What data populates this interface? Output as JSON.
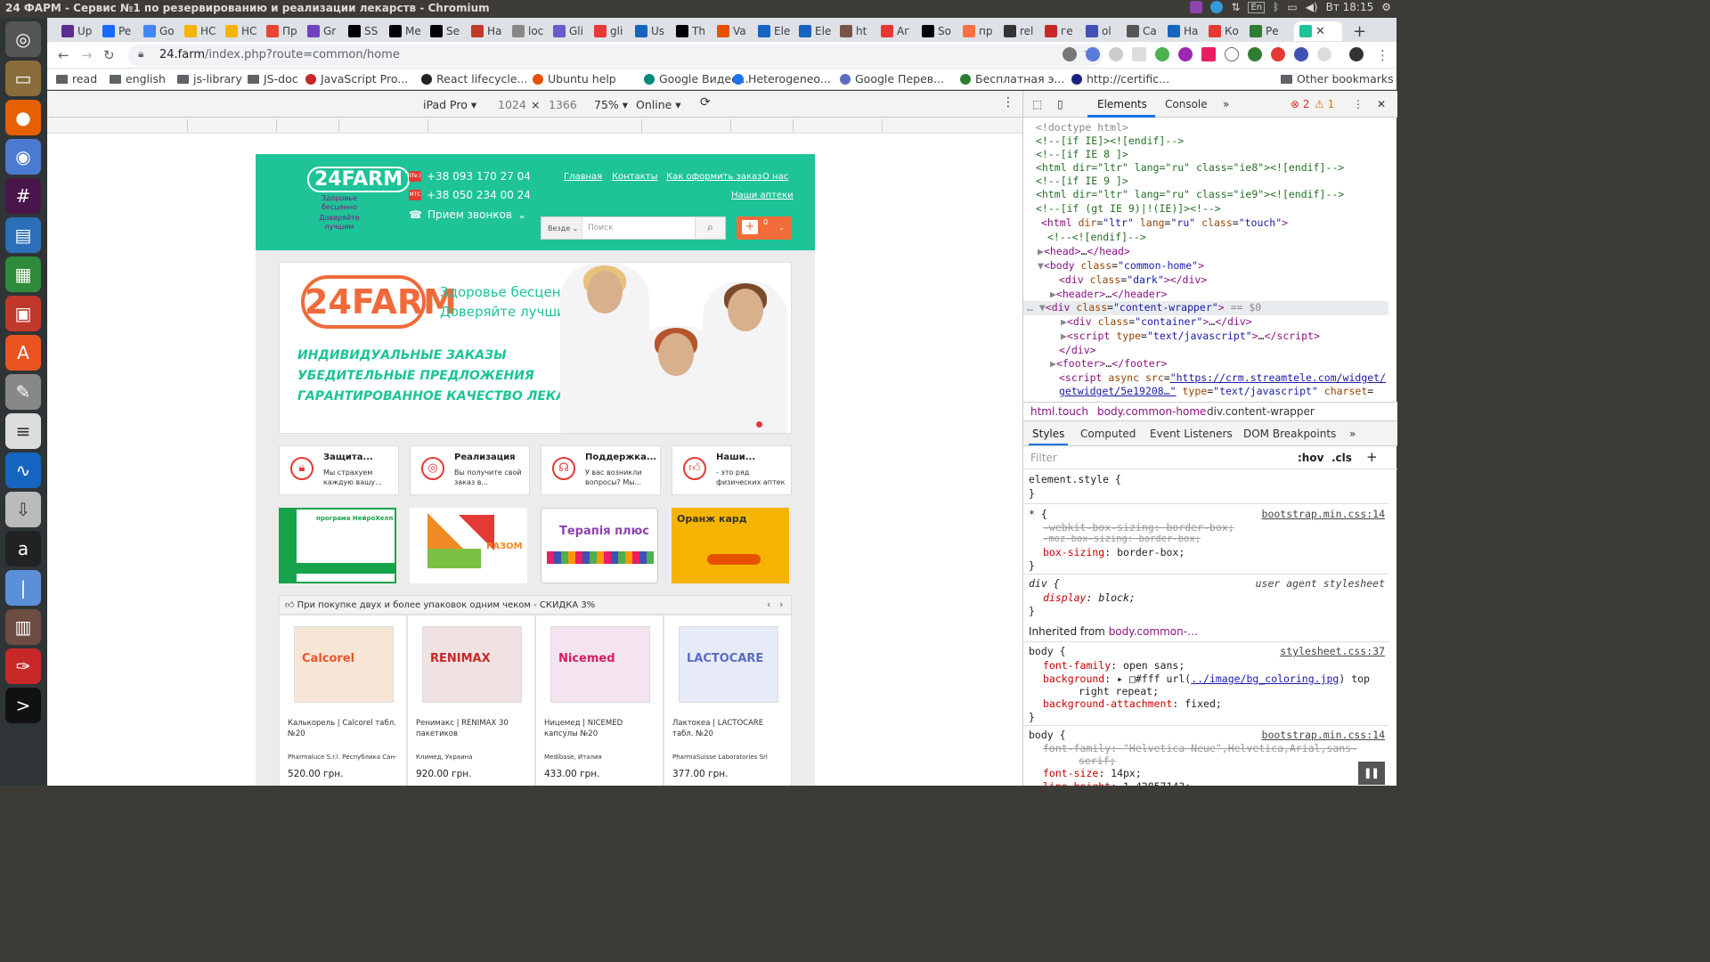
{
  "window_title": "24 ФАРМ - Сервис №1 по резервированию и реализации лекарств - Chromium",
  "tray": {
    "lang": "En",
    "clock": "Вт 18:15"
  },
  "tabs": [
    "Up",
    "Pe",
    "Go",
    "НС",
    "НС",
    "Пр",
    "Gr",
    "SS",
    "Ме",
    "Se",
    "На",
    "loc",
    "Gli",
    "gli",
    "Us",
    "Th",
    "Va",
    "Ele",
    "Ele",
    "ht",
    "Аг",
    "So",
    "пр",
    "rel",
    "ге",
    "ol",
    "Ca",
    "На",
    "Ко",
    "Ре"
  ],
  "address": {
    "host": "24.farm",
    "path": "/index.php?route=common/home"
  },
  "bookmarks": [
    "read",
    "english",
    "js-library",
    "JS-doc",
    "JavaScript Pro...",
    "React lifecycle...",
    "Ubuntu help",
    "Google Видео...",
    "Heterogeneo...",
    "Google Перев...",
    "Бесплатная э...",
    "http://certific...",
    "Other bookmarks"
  ],
  "device": {
    "name": "iPad Pro",
    "width": "1024",
    "x": "×",
    "height": "1366",
    "zoom": "75%",
    "network": "Online"
  },
  "site": {
    "logo": {
      "brand": "24FARM",
      "tagline1": "Здоровье бесценно",
      "tagline2": "Доверяйте лучшим"
    },
    "phones": [
      "+38 093 170 27 04",
      "+38 050 234 00 24"
    ],
    "phone_icons": [
      "life:)",
      "МТС"
    ],
    "callback": "Прием звонков",
    "nav": [
      "Главная",
      "Контакты",
      "Как оформить заказ",
      "О нас",
      "Наши аптеки"
    ],
    "search": {
      "scope": "Везде",
      "placeholder": "Поиск"
    },
    "cart_count": "0",
    "banner": {
      "logo": "24FARM",
      "sub1": "Здоровье бесценно",
      "sub2": "Доверяйте лучшим",
      "lines": [
        "ИНДИВИДУАЛЬНЫЕ ЗАКАЗЫ",
        "УБЕДИТЕЛЬНЫЕ ПРЕДЛОЖЕНИЯ",
        "ГАРАНТИРОВАННОЕ КАЧЕСТВО ЛЕКАРСТВ"
      ]
    },
    "features": [
      {
        "title": "Защита...",
        "desc": "Мы страхуем каждую вашу..."
      },
      {
        "title": "Реализация",
        "desc": "Вы получите свой заказ в..."
      },
      {
        "title": "Поддержка...",
        "desc": "У вас возникли вопросы? Мы..."
      },
      {
        "title": "Наши...",
        "desc": "- это ряд физических аптек"
      }
    ],
    "promos": [
      {
        "text": "програма НейроХелп",
        "color": "#16a34a"
      },
      {
        "text": "РАЗОМ",
        "color": "#f08a24"
      },
      {
        "text": "Терапія плюс",
        "color": "#8e44ad"
      },
      {
        "text": "Оранж кард",
        "color": "#f5b400"
      }
    ],
    "deals_title": "При покупке двух и более упаковок одним чеком - СКИДКА 3%",
    "products": [
      {
        "name": "Калькорель | Calcorel табл. №20",
        "maker": "Pharmaluce S.r.l. Республика Сан-",
        "price": "520.00 грн.",
        "box": "Calcorel"
      },
      {
        "name": "Ренимакс | RENIMAX 30 пакетиков",
        "maker": "Климед, Украина",
        "price": "920.00 грн.",
        "box": "RENIMAX"
      },
      {
        "name": "Ницемед | NICEMED капсулы №20",
        "maker": "Medibase, Италия",
        "price": "433.00 грн.",
        "box": "Nicemed"
      },
      {
        "name": "Лактокеа | LACTOCARE табл. №20",
        "maker": "PharmaSuisse Laboratories Srl",
        "price": "377.00 грн.",
        "box": "LACTOCARE"
      }
    ]
  },
  "devtools": {
    "tabs": [
      "Elements",
      "Console"
    ],
    "errors": "2",
    "warnings": "1",
    "dom": [
      "<!doctype html>",
      "<!--[if IE]><![endif]-->",
      "<!--[if IE 8 ]>",
      "<html dir=\"ltr\" lang=\"ru\" class=\"ie8\"><![endif]-->",
      "<!--[if IE 9 ]>",
      "<html dir=\"ltr\" lang=\"ru\" class=\"ie9\"><![endif]-->",
      "<!--[if (gt IE 9)|!(IE)]><!-->"
    ],
    "crumbs": [
      "html.touch",
      "body.common-home",
      "div.content-wrapper"
    ],
    "subtabs": [
      "Styles",
      "Computed",
      "Event Listeners",
      "DOM Breakpoints"
    ],
    "filter_placeholder": "Filter",
    "hov": ":hov",
    "cls": ".cls",
    "inherited": "Inherited from",
    "inherited_from": "body.common-…"
  }
}
